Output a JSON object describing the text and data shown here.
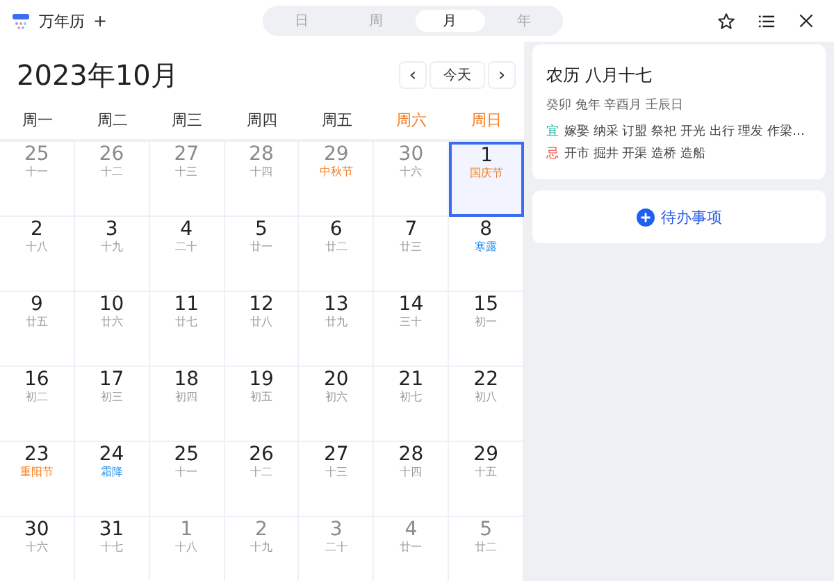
{
  "app": {
    "title": "万年历",
    "add": "+"
  },
  "views": [
    {
      "label": "日",
      "selected": false
    },
    {
      "label": "周",
      "selected": false
    },
    {
      "label": "月",
      "selected": true
    },
    {
      "label": "年",
      "selected": false
    }
  ],
  "calendar": {
    "title": "2023年10月",
    "prev": "‹",
    "today": "今天",
    "next": "›",
    "weekdays": [
      {
        "label": "周一",
        "weekend": false
      },
      {
        "label": "周二",
        "weekend": false
      },
      {
        "label": "周三",
        "weekend": false
      },
      {
        "label": "周四",
        "weekend": false
      },
      {
        "label": "周五",
        "weekend": false
      },
      {
        "label": "周六",
        "weekend": true
      },
      {
        "label": "周日",
        "weekend": true
      }
    ],
    "days": [
      {
        "day": "25",
        "sub": "十一",
        "kind": "lunar",
        "in_month": false,
        "selected": false
      },
      {
        "day": "26",
        "sub": "十二",
        "kind": "lunar",
        "in_month": false,
        "selected": false
      },
      {
        "day": "27",
        "sub": "十三",
        "kind": "lunar",
        "in_month": false,
        "selected": false
      },
      {
        "day": "28",
        "sub": "十四",
        "kind": "lunar",
        "in_month": false,
        "selected": false
      },
      {
        "day": "29",
        "sub": "中秋节",
        "kind": "festival",
        "in_month": false,
        "selected": false
      },
      {
        "day": "30",
        "sub": "十六",
        "kind": "lunar",
        "in_month": false,
        "selected": false
      },
      {
        "day": "1",
        "sub": "国庆节",
        "kind": "festival",
        "in_month": true,
        "selected": true
      },
      {
        "day": "2",
        "sub": "十八",
        "kind": "lunar",
        "in_month": true,
        "selected": false
      },
      {
        "day": "3",
        "sub": "十九",
        "kind": "lunar",
        "in_month": true,
        "selected": false
      },
      {
        "day": "4",
        "sub": "二十",
        "kind": "lunar",
        "in_month": true,
        "selected": false
      },
      {
        "day": "5",
        "sub": "廿一",
        "kind": "lunar",
        "in_month": true,
        "selected": false
      },
      {
        "day": "6",
        "sub": "廿二",
        "kind": "lunar",
        "in_month": true,
        "selected": false
      },
      {
        "day": "7",
        "sub": "廿三",
        "kind": "lunar",
        "in_month": true,
        "selected": false
      },
      {
        "day": "8",
        "sub": "寒露",
        "kind": "term",
        "in_month": true,
        "selected": false
      },
      {
        "day": "9",
        "sub": "廿五",
        "kind": "lunar",
        "in_month": true,
        "selected": false
      },
      {
        "day": "10",
        "sub": "廿六",
        "kind": "lunar",
        "in_month": true,
        "selected": false
      },
      {
        "day": "11",
        "sub": "廿七",
        "kind": "lunar",
        "in_month": true,
        "selected": false
      },
      {
        "day": "12",
        "sub": "廿八",
        "kind": "lunar",
        "in_month": true,
        "selected": false
      },
      {
        "day": "13",
        "sub": "廿九",
        "kind": "lunar",
        "in_month": true,
        "selected": false
      },
      {
        "day": "14",
        "sub": "三十",
        "kind": "lunar",
        "in_month": true,
        "selected": false
      },
      {
        "day": "15",
        "sub": "初一",
        "kind": "lunar",
        "in_month": true,
        "selected": false
      },
      {
        "day": "16",
        "sub": "初二",
        "kind": "lunar",
        "in_month": true,
        "selected": false
      },
      {
        "day": "17",
        "sub": "初三",
        "kind": "lunar",
        "in_month": true,
        "selected": false
      },
      {
        "day": "18",
        "sub": "初四",
        "kind": "lunar",
        "in_month": true,
        "selected": false
      },
      {
        "day": "19",
        "sub": "初五",
        "kind": "lunar",
        "in_month": true,
        "selected": false
      },
      {
        "day": "20",
        "sub": "初六",
        "kind": "lunar",
        "in_month": true,
        "selected": false
      },
      {
        "day": "21",
        "sub": "初七",
        "kind": "lunar",
        "in_month": true,
        "selected": false
      },
      {
        "day": "22",
        "sub": "初八",
        "kind": "lunar",
        "in_month": true,
        "selected": false
      },
      {
        "day": "23",
        "sub": "重阳节",
        "kind": "festival",
        "in_month": true,
        "selected": false
      },
      {
        "day": "24",
        "sub": "霜降",
        "kind": "term",
        "in_month": true,
        "selected": false
      },
      {
        "day": "25",
        "sub": "十一",
        "kind": "lunar",
        "in_month": true,
        "selected": false
      },
      {
        "day": "26",
        "sub": "十二",
        "kind": "lunar",
        "in_month": true,
        "selected": false
      },
      {
        "day": "27",
        "sub": "十三",
        "kind": "lunar",
        "in_month": true,
        "selected": false
      },
      {
        "day": "28",
        "sub": "十四",
        "kind": "lunar",
        "in_month": true,
        "selected": false
      },
      {
        "day": "29",
        "sub": "十五",
        "kind": "lunar",
        "in_month": true,
        "selected": false
      },
      {
        "day": "30",
        "sub": "十六",
        "kind": "lunar",
        "in_month": true,
        "selected": false
      },
      {
        "day": "31",
        "sub": "十七",
        "kind": "lunar",
        "in_month": true,
        "selected": false
      },
      {
        "day": "1",
        "sub": "十八",
        "kind": "lunar",
        "in_month": false,
        "selected": false
      },
      {
        "day": "2",
        "sub": "十九",
        "kind": "lunar",
        "in_month": false,
        "selected": false
      },
      {
        "day": "3",
        "sub": "二十",
        "kind": "lunar",
        "in_month": false,
        "selected": false
      },
      {
        "day": "4",
        "sub": "廿一",
        "kind": "lunar",
        "in_month": false,
        "selected": false
      },
      {
        "day": "5",
        "sub": "廿二",
        "kind": "lunar",
        "in_month": false,
        "selected": false
      }
    ]
  },
  "detail": {
    "lunar_date": "农历 八月十七",
    "ganzhi": "癸卯 兔年 辛酉月 壬辰日",
    "omens": [
      {
        "kind": "good",
        "mark": "宜",
        "items": "嫁娶 纳采 订盟 祭祀 开光 出行 理发 作梁…"
      },
      {
        "kind": "bad",
        "mark": "忌",
        "items": "开市 掘井 开渠 造桥 造船"
      }
    ]
  },
  "todo": {
    "label": "待办事项"
  }
}
